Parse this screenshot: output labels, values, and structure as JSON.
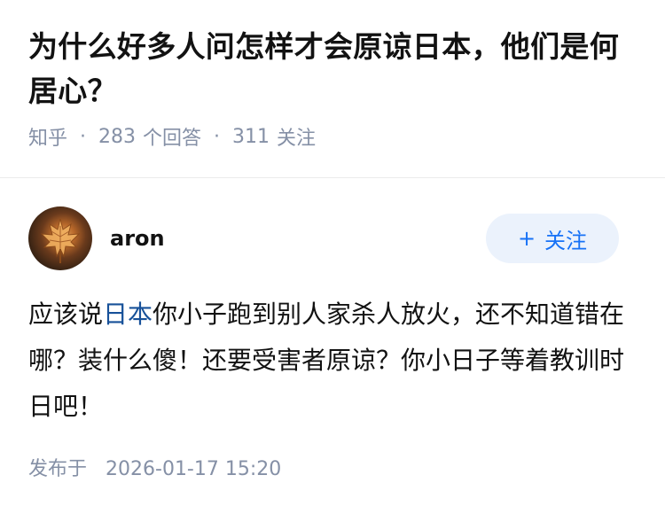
{
  "question": {
    "title": "为什么好多人问怎样才会原谅日本，他们是何居心？",
    "source": "知乎",
    "answer_count": "283",
    "answer_label": "个回答",
    "follower_count": "311",
    "follower_label": "关注"
  },
  "answer": {
    "author": {
      "name": "aron",
      "avatar": "maple-leaf-avatar"
    },
    "follow_button": {
      "icon": "+",
      "label": "关注"
    },
    "content": {
      "before_link": "应该说",
      "link_text": "日本",
      "after_link": "你小子跑到别人家杀人放火，还不知道错在哪？装什么傻！还要受害者原谅？你小日子等着教训时日吧！"
    },
    "publish": {
      "label": "发布于",
      "time": "2026-01-17 15:20"
    }
  },
  "colors": {
    "text": "#121212",
    "meta": "#8590a6",
    "link": "#175199",
    "follow_bg": "#ebf2fc",
    "follow_text": "#1772f6"
  }
}
